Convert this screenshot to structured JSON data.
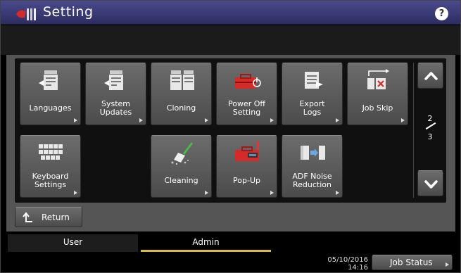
{
  "title": "Setting",
  "help_label": "?",
  "tiles": [
    {
      "label": "Languages",
      "icon": "languages-icon"
    },
    {
      "label": "System\nUpdates",
      "icon": "system-updates-icon"
    },
    {
      "label": "Cloning",
      "icon": "cloning-icon"
    },
    {
      "label": "Power Off\nSetting",
      "icon": "power-off-toolbox-icon"
    },
    {
      "label": "Export\nLogs",
      "icon": "export-logs-icon"
    },
    {
      "label": "Job Skip",
      "icon": "job-skip-icon"
    },
    {
      "label": "Keyboard\nSettings",
      "icon": "keyboard-icon"
    },
    {
      "label": "Cleaning",
      "icon": "cleaning-broom-icon"
    },
    {
      "label": "Pop-Up",
      "icon": "pop-up-toolbox-icon"
    },
    {
      "label": "ADF Noise\nReduction",
      "icon": "adf-noise-icon"
    }
  ],
  "pagination": {
    "current": "2",
    "total": "3"
  },
  "return_label": "Return",
  "tabs": [
    {
      "label": "User"
    },
    {
      "label": "Admin",
      "active": true
    }
  ],
  "datetime": {
    "date": "05/10/2016",
    "time": "14:16"
  },
  "job_status_label": "Job Status",
  "colors": {
    "titlebar": "#3c3c78",
    "tab_accent": "#d8bc48",
    "toolbox_red": "#d42a2a"
  }
}
